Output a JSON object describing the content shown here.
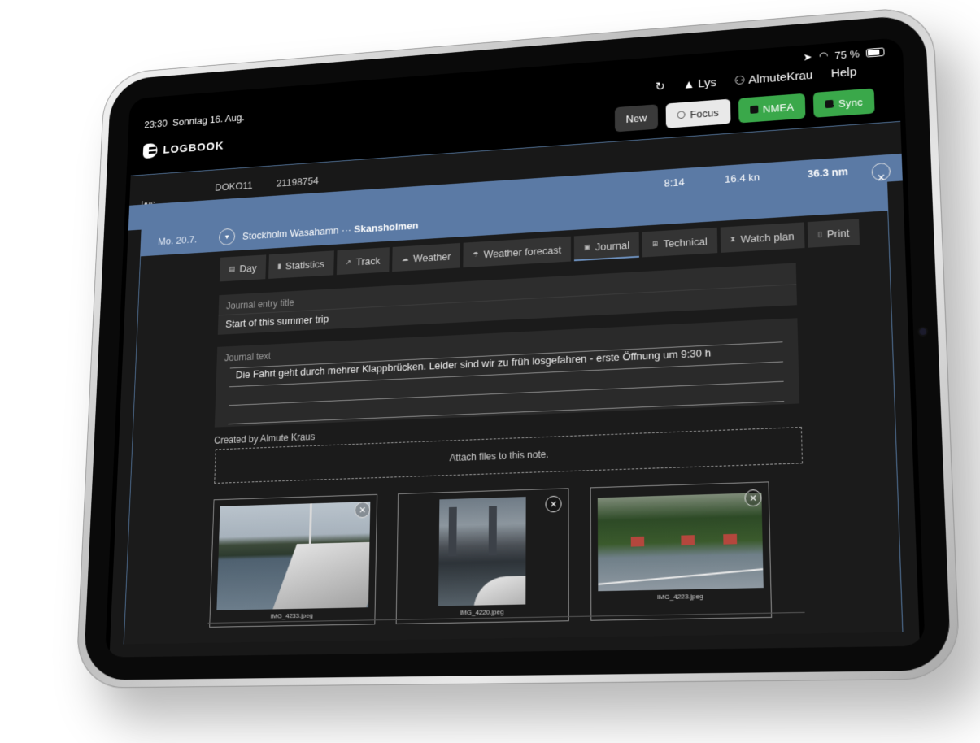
{
  "status": {
    "time": "23:30",
    "date": "Sonntag 16. Aug.",
    "battery": "75 %"
  },
  "topnav": {
    "boat": "Lys",
    "user": "AlmuteKrau",
    "help": "Help"
  },
  "header": {
    "logo": "LOGBOOK",
    "buttons": {
      "new": "New",
      "focus": "Focus",
      "nmea": "NMEA",
      "sync": "Sync"
    }
  },
  "boatline": {
    "boat": "Lys",
    "code": "DOKO11",
    "number": "21198754"
  },
  "trackrow": {
    "time": "8:14",
    "speed": "16.4 kn",
    "distance": "36.3 nm"
  },
  "day": {
    "date": "Mo. 20.7.",
    "from": "Stockholm Wasahamn",
    "separator": "···",
    "to": "Skansholmen"
  },
  "tabs": [
    {
      "label": "Day",
      "icon": "calendar-icon"
    },
    {
      "label": "Statistics",
      "icon": "chart-icon"
    },
    {
      "label": "Track",
      "icon": "track-icon"
    },
    {
      "label": "Weather",
      "icon": "weather-icon"
    },
    {
      "label": "Weather forecast",
      "icon": "forecast-icon"
    },
    {
      "label": "Journal",
      "icon": "journal-icon",
      "active": true
    },
    {
      "label": "Technical",
      "icon": "technical-icon"
    },
    {
      "label": "Watch plan",
      "icon": "hourglass-icon"
    },
    {
      "label": "Print",
      "icon": "print-icon"
    }
  ],
  "journal": {
    "title_label": "Journal entry title",
    "title_value": "Start of this summer trip",
    "text_label": "Journal text",
    "text_value": "Die Fahrt geht durch mehrer Klappbrücken. Leider sind wir zu früh losgefahren - erste Öffnung um 9:30 h",
    "created_by": "Created by Almute Kraus",
    "attach": "Attach files to this note."
  },
  "photos": [
    {
      "caption": "IMG_4233.jpeg"
    },
    {
      "caption": "IMG_4220.jpeg"
    },
    {
      "caption": "IMG_4223.jpeg"
    }
  ],
  "colors": {
    "accent": "#5b7aa5",
    "green": "#3aa84a",
    "background": "#181818"
  }
}
